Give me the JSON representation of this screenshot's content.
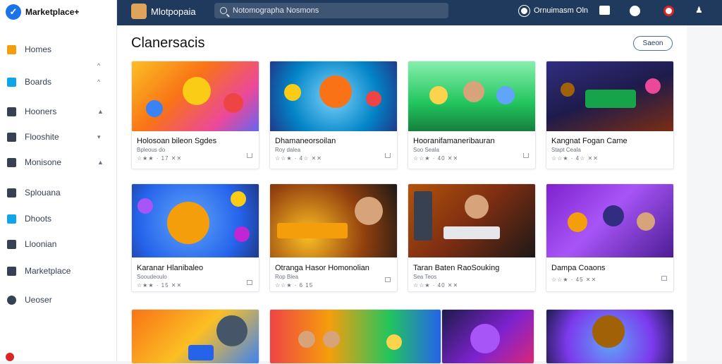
{
  "brand": {
    "name": "Marketplace+"
  },
  "sidebar": {
    "items": [
      {
        "label": "Homes",
        "icon": "home-icon",
        "color": "#f59e0b"
      },
      {
        "label": "Boards",
        "icon": "board-icon",
        "color": "#0ea5e9"
      },
      {
        "label": "Hooners",
        "icon": "bookmark-icon",
        "color": "#374151"
      },
      {
        "label": "Flooshite",
        "icon": "folder-icon",
        "color": "#374151"
      },
      {
        "label": "Monisone",
        "icon": "document-icon",
        "color": "#374151"
      },
      {
        "label": "Splouana",
        "icon": "chart-icon",
        "color": "#374151"
      },
      {
        "label": "Dhoots",
        "icon": "info-icon",
        "color": "#0ea5e9"
      },
      {
        "label": "Lloonian",
        "icon": "box-icon",
        "color": "#374151"
      },
      {
        "label": "Marketplace",
        "icon": "tag-icon",
        "color": "#374151"
      },
      {
        "label": "Ueoser",
        "icon": "user-circle-icon",
        "color": "#374151"
      }
    ]
  },
  "topbar": {
    "app_title": "Mlotpopaia",
    "search_value": "Notomographa Nosmons",
    "status_text": "Ornuimasm Oln"
  },
  "main": {
    "title": "Clanersacis",
    "action_label": "Saeon"
  },
  "cards": [
    {
      "title": "Holosoan bileon Sgdes",
      "sub": "Bpleous do",
      "meta": "☆★★ · 17 ✕✕"
    },
    {
      "title": "Dhamaneorsoilan",
      "sub": "Roy dalea",
      "meta": "☆☆★ · 4☆ ✕✕"
    },
    {
      "title": "Hooranifamaneribauran",
      "sub": "Soo Seala",
      "meta": "☆☆★ · 40 ✕✕"
    },
    {
      "title": "Kangnat Fogan Came",
      "sub": "Stapt Ceala",
      "meta": "☆☆★ · 4☆ ✕✕"
    },
    {
      "title": "Karanar Hlanibaleo",
      "sub": "Sooudeoulo",
      "meta": "☆★★ · 15 ✕✕"
    },
    {
      "title": "Otranga Hasor Homonolian",
      "sub": "Rop Blea",
      "meta": "☆☆★ · 6 15"
    },
    {
      "title": "Taran Baten RaoSouking",
      "sub": "Sea Teos",
      "meta": "☆☆★ · 40 ✕✕"
    },
    {
      "title": "Dampa Coaons",
      "sub": "",
      "meta": "☆☆★ · 45 ✕✕"
    }
  ]
}
